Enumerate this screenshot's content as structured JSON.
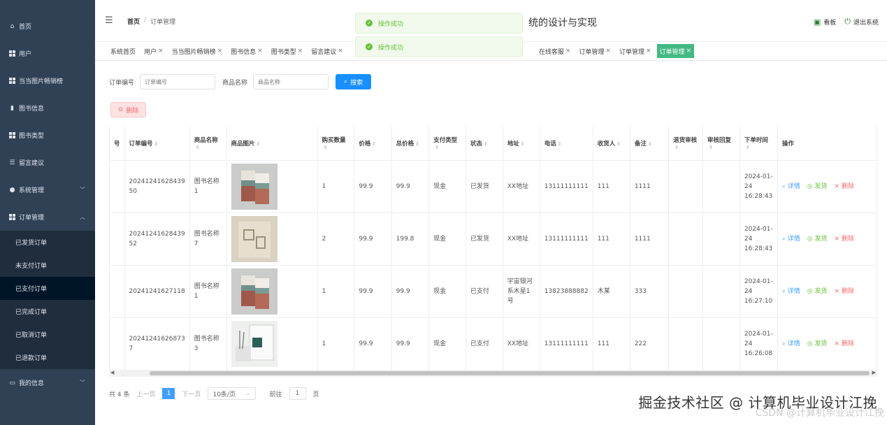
{
  "sidebar": {
    "items": [
      {
        "label": "首页",
        "icon": "home-icon"
      },
      {
        "label": "用户",
        "icon": "grid-icon"
      },
      {
        "label": "当当图片畅销榜",
        "icon": "grid-icon"
      },
      {
        "label": "图书信息",
        "icon": "chart-icon"
      },
      {
        "label": "图书类型",
        "icon": "grid-icon"
      },
      {
        "label": "留言建议",
        "icon": "list-icon"
      },
      {
        "label": "系统管理",
        "icon": "pin-icon"
      },
      {
        "label": "订单管理",
        "icon": "grid-icon"
      }
    ],
    "submenu": [
      "已发货订单",
      "未支付订单",
      "已支付订单",
      "已完成订单",
      "已取消订单",
      "已退款订单"
    ],
    "last": {
      "label": "我的信息"
    }
  },
  "header": {
    "breadcrumb_home": "首页",
    "breadcrumb_sep": "/",
    "breadcrumb_current": "订单管理",
    "title": "统的设计与实现",
    "board": "看板",
    "logout": "退出系统"
  },
  "toasts": [
    "操作成功",
    "操作成功"
  ],
  "tabs": [
    {
      "label": "系统首页",
      "close": false
    },
    {
      "label": "用户",
      "close": true
    },
    {
      "label": "当当图片畅销榜",
      "close": true
    },
    {
      "label": "图书信息",
      "close": true
    },
    {
      "label": "图书类型",
      "close": true
    },
    {
      "label": "留言建议",
      "close": true
    },
    {
      "label": "在线客服",
      "close": true
    },
    {
      "label": "订单管理",
      "close": true
    },
    {
      "label": "订单管理",
      "close": true
    },
    {
      "label": "订单管理",
      "close": true
    }
  ],
  "search": {
    "order_label": "订单编号",
    "order_placeholder": "订单编号",
    "name_label": "商品名称",
    "name_placeholder": "商品名称",
    "button": "搜索"
  },
  "delete_button": "删除",
  "table": {
    "headers": [
      "号",
      "订单编号",
      "商品名称",
      "商品图片",
      "购买数量",
      "价格",
      "总价格",
      "支付类型",
      "状态",
      "地址",
      "电话",
      "收货人",
      "备注",
      "退货审核",
      "审核回复",
      "下单时间",
      "操作"
    ],
    "rows": [
      {
        "order_no": "20241241628439 50",
        "name": "图书名称1",
        "qty": "1",
        "price": "99.9",
        "total": "99.9",
        "pay": "现金",
        "status": "已发货",
        "addr": "XX地址",
        "phone": "13111111111",
        "receiver": "111",
        "remark": "1111",
        "time": "2024-01-24 16:28:43",
        "img": "book-a"
      },
      {
        "order_no": "20241241628439 52",
        "name": "图书名称7",
        "qty": "2",
        "price": "99.9",
        "total": "199.8",
        "pay": "现金",
        "status": "已发货",
        "addr": "XX地址",
        "phone": "13111111111",
        "receiver": "111",
        "remark": "1111",
        "time": "2024-01-24 16:28:43",
        "img": "book-b"
      },
      {
        "order_no": "20241241627118",
        "name": "图书名称1",
        "qty": "1",
        "price": "99.9",
        "total": "99.9",
        "pay": "现金",
        "status": "已支付",
        "addr": "宇宙银河系木星1号",
        "phone": "13823888882",
        "receiver": "木某",
        "remark": "333",
        "time": "2024-01-24 16:27:10",
        "img": "book-a"
      },
      {
        "order_no": "20241241626873 7",
        "name": "图书名称3",
        "qty": "1",
        "price": "99.9",
        "total": "99.9",
        "pay": "现金",
        "status": "已支付",
        "addr": "XX地址",
        "phone": "13111111111",
        "receiver": "111",
        "remark": "222",
        "time": "2024-01-24 16:26:08",
        "img": "book-c"
      }
    ],
    "actions": {
      "detail": "详情",
      "ship": "发货",
      "delete": "删除"
    }
  },
  "pager": {
    "total": "共 4 条",
    "prev": "上一页",
    "page": "1",
    "next": "下一页",
    "size": "10条/页",
    "goto": "前往",
    "goto_val": "1",
    "page_unit": "页"
  },
  "watermark": "掘金技术社区 @ 计算机毕业设计江挽",
  "watermark2": "CSDN @计算机毕业设计江挽"
}
